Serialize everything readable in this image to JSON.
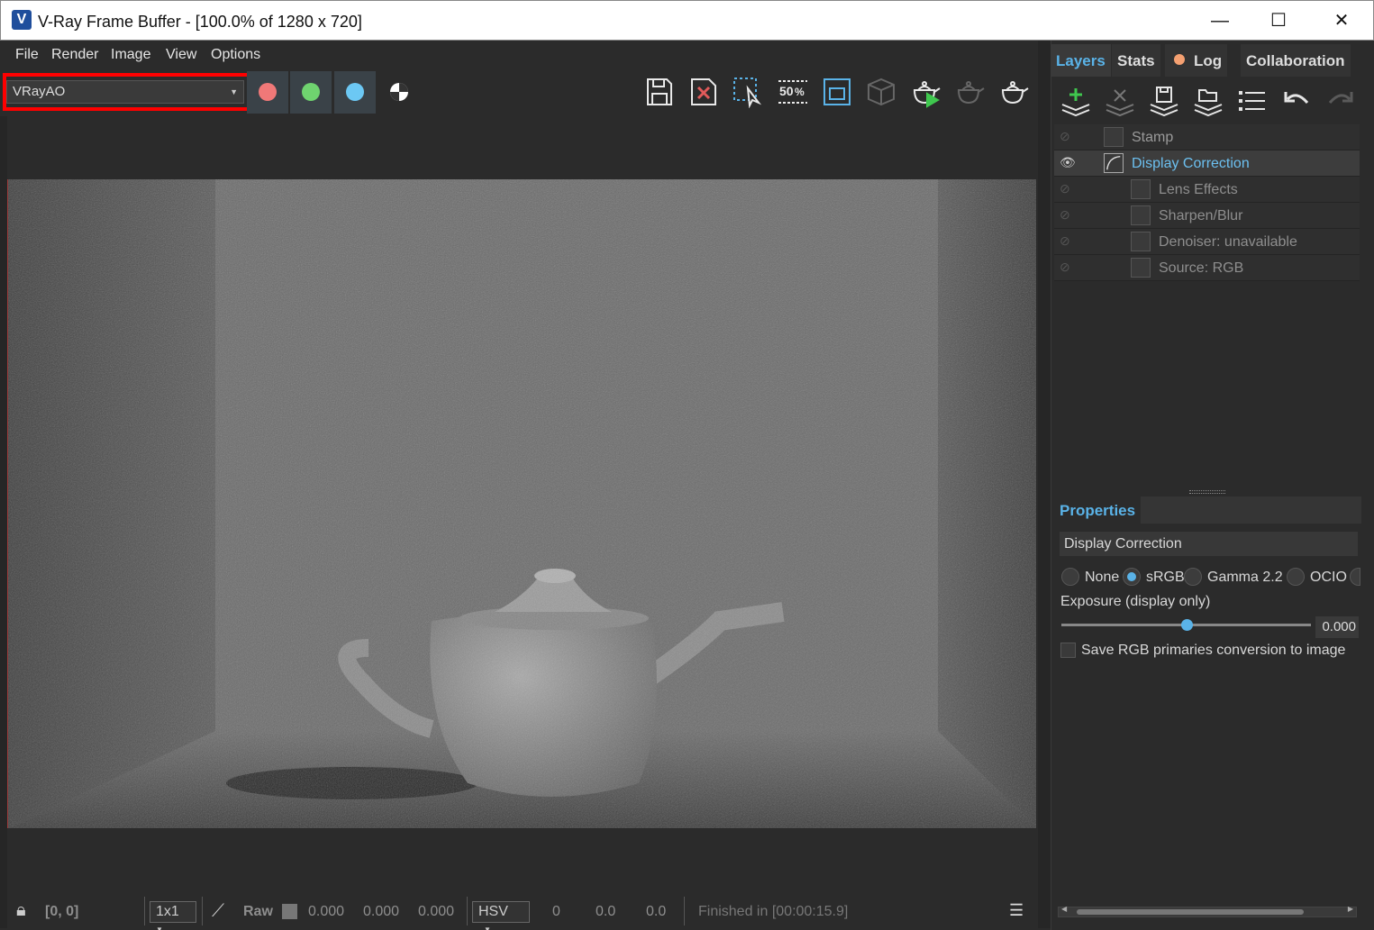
{
  "window": {
    "title": "V-Ray Frame Buffer - [100.0% of 1280 x 720]",
    "logo": "V",
    "controls": {
      "minimize": "—",
      "maximize": "☐",
      "close": "✕"
    }
  },
  "menu": [
    "File",
    "Render",
    "Image",
    "View",
    "Options"
  ],
  "toolbar": {
    "channel": "VRayAO",
    "channel_buttons": [
      {
        "name": "red-channel-button",
        "color": "#f07878"
      },
      {
        "name": "green-channel-button",
        "color": "#6fd36f"
      },
      {
        "name": "blue-channel-button",
        "color": "#6cc8f4"
      }
    ],
    "icons": [
      "save-icon",
      "clear-image-icon",
      "region-render-icon",
      "50-percent-icon",
      "fit-view-icon",
      "track-mouse-icon",
      "render-interactive-icon",
      "stop-render-icon",
      "render-icon"
    ],
    "zoom_badge": "50%"
  },
  "status": {
    "coords": "[0, 0]",
    "sample_size": "1x1",
    "raw_label": "Raw",
    "r": "0.000",
    "g": "0.000",
    "b": "0.000",
    "color_mode": "HSV",
    "h": "0",
    "s": "0.0",
    "v": "0.0",
    "message": "Finished in [00:00:15.9]"
  },
  "panel": {
    "tabs": [
      "Layers",
      "Stats",
      "Log",
      "Collaboration"
    ],
    "layer_tools": [
      "add-layer-icon",
      "delete-layer-icon",
      "save-layers-icon",
      "load-layers-icon",
      "layer-list-icon",
      "undo-icon",
      "redo-icon"
    ],
    "layers": [
      {
        "label": "Stamp",
        "icon": "stamp-icon",
        "indent": 0
      },
      {
        "label": "Display Correction",
        "icon": "curve-icon",
        "indent": 0,
        "selected": true
      },
      {
        "label": "Lens Effects",
        "icon": "lens-effects-icon",
        "indent": 1
      },
      {
        "label": "Sharpen/Blur",
        "icon": "sharpen-icon",
        "indent": 1
      },
      {
        "label": "Denoiser: unavailable",
        "icon": "denoiser-icon",
        "indent": 1
      },
      {
        "label": "Source: RGB",
        "icon": "source-icon",
        "indent": 1
      }
    ],
    "properties": {
      "title": "Properties",
      "section": "Display Correction",
      "options": [
        "None",
        "sRGB",
        "Gamma 2.2",
        "OCIO"
      ],
      "selected_option": "sRGB",
      "exposure_label": "Exposure (display only)",
      "exposure_value": "0.000",
      "exposure_fraction": 0.5,
      "save_rgb_label": "Save RGB primaries conversion to image"
    }
  }
}
